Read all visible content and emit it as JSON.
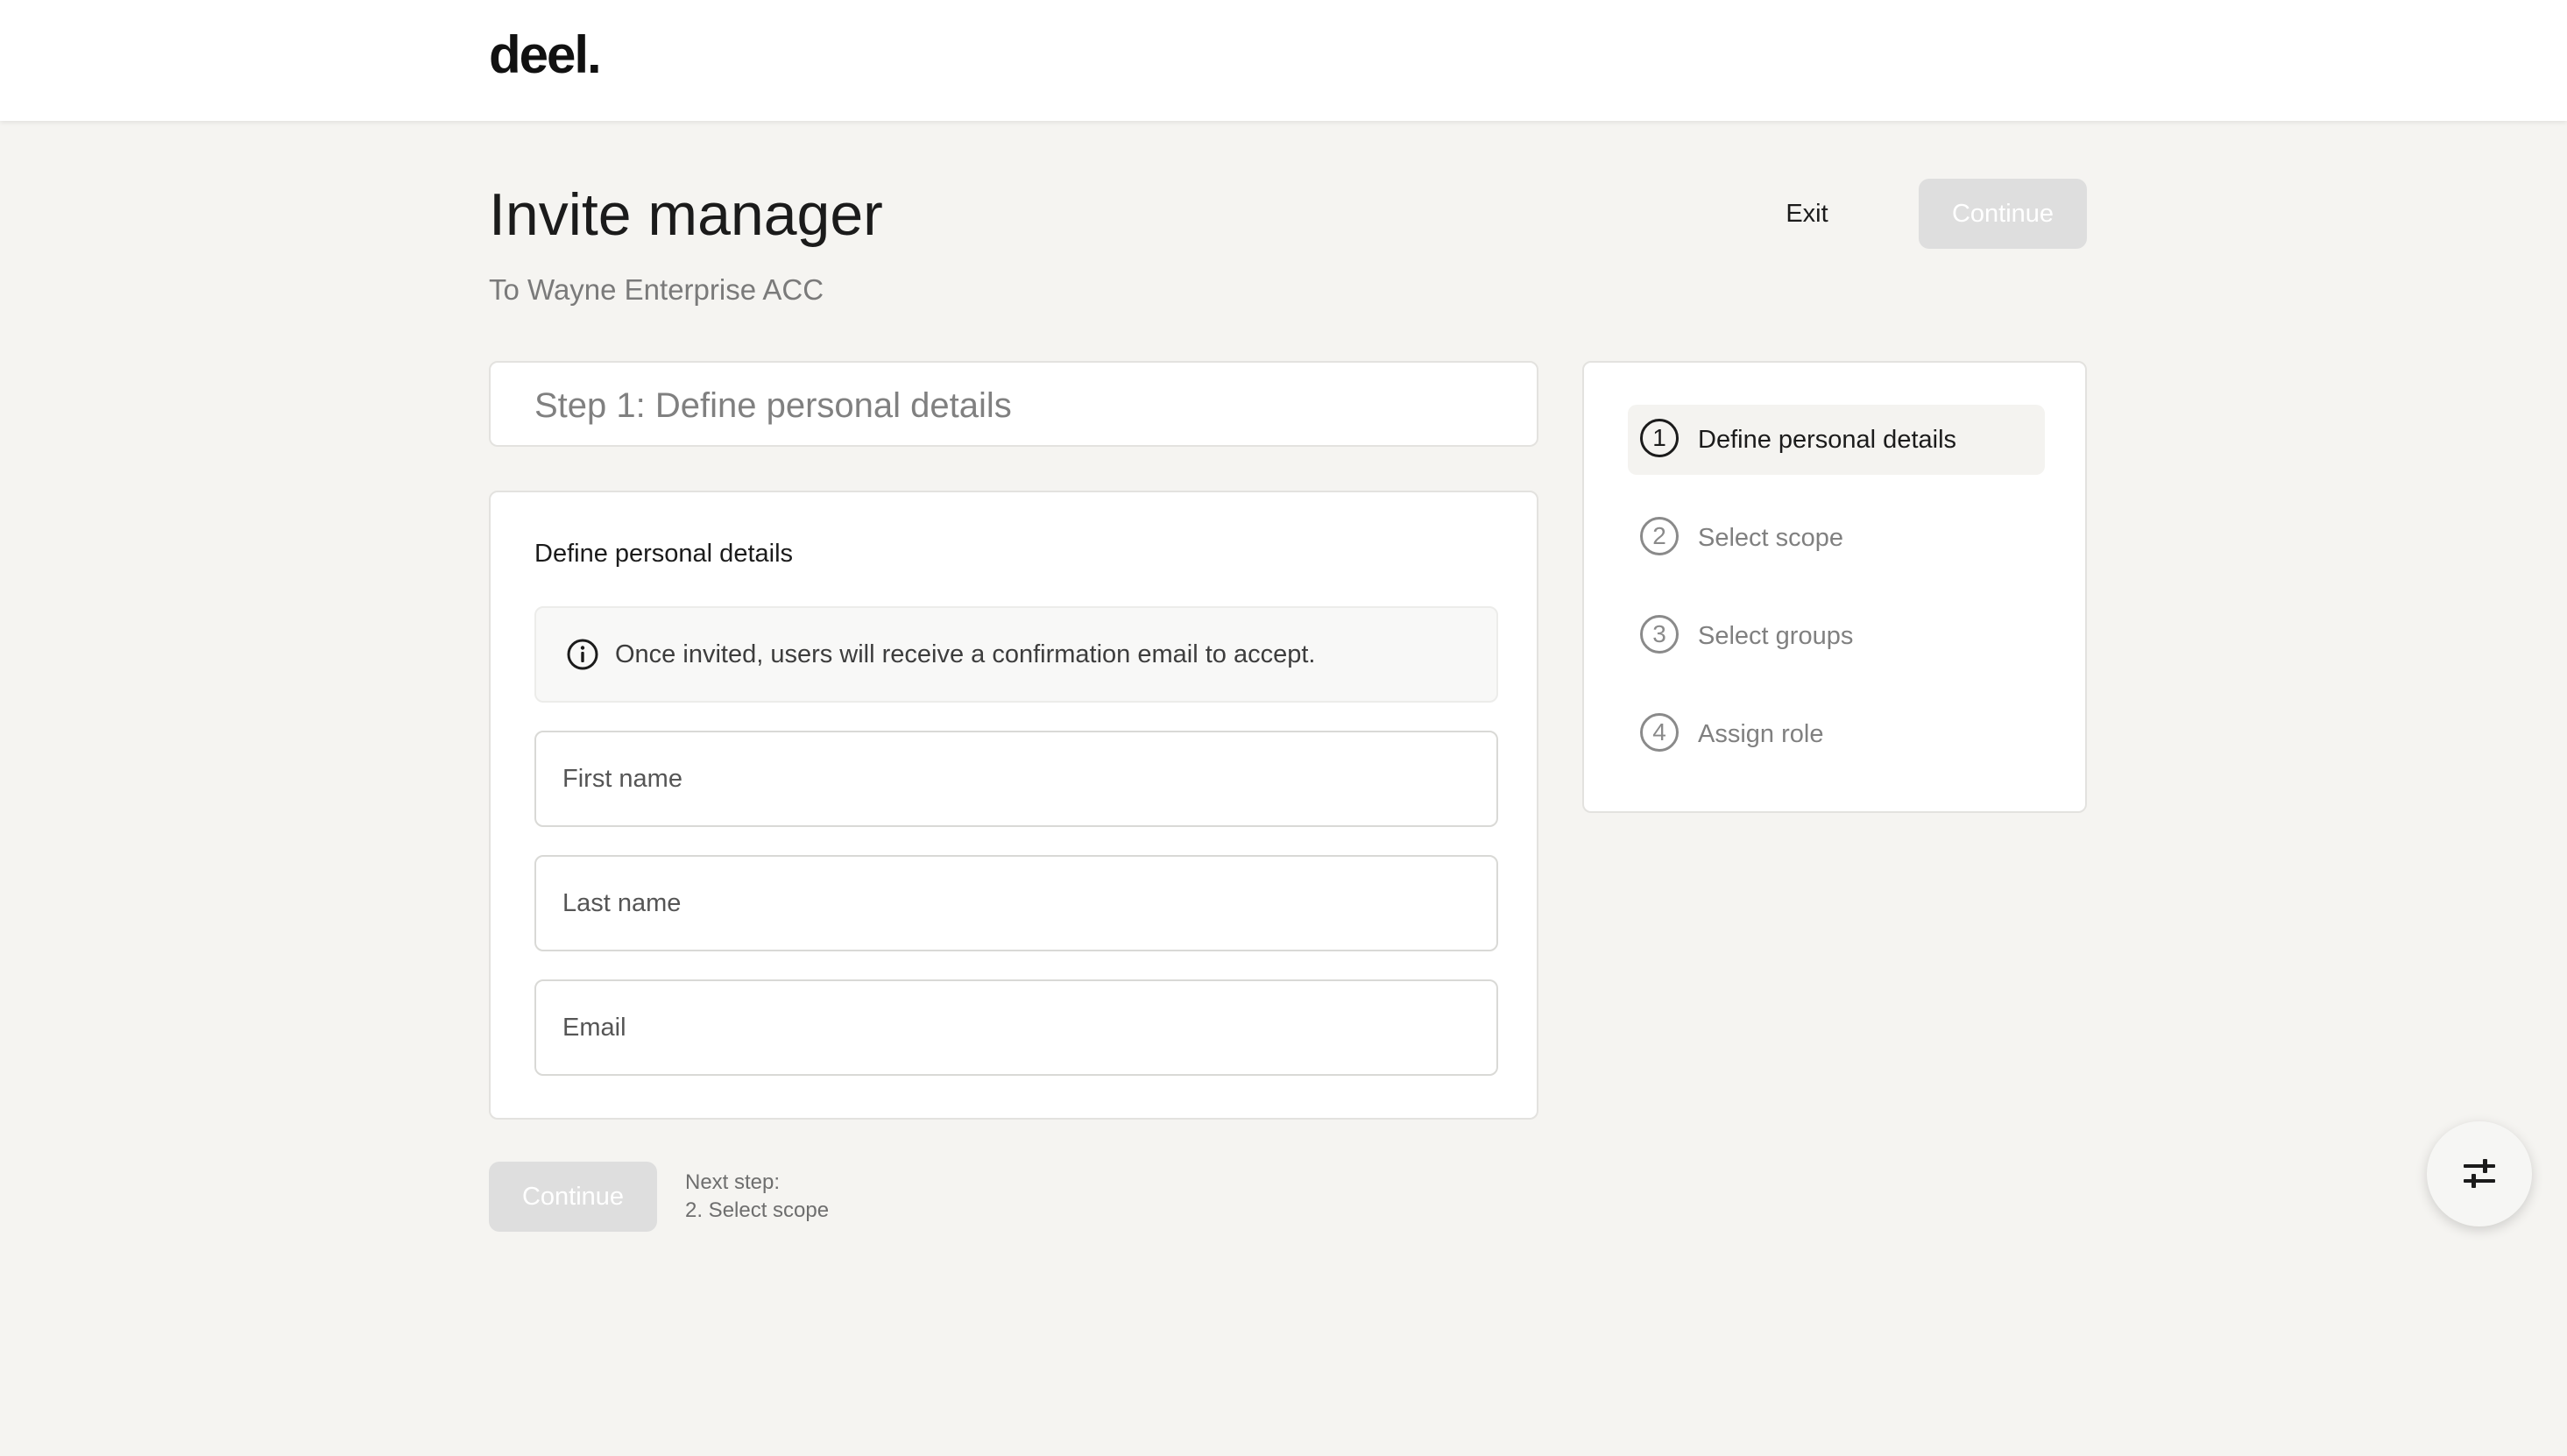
{
  "header": {
    "logo_text": "deel."
  },
  "page": {
    "title": "Invite manager",
    "subtitle": "To Wayne Enterprise ACC",
    "exit_label": "Exit",
    "continue_label": "Continue"
  },
  "step_header": {
    "text": "Step 1: Define personal details"
  },
  "form": {
    "title": "Define personal details",
    "info_text": "Once invited, users will receive a confirmation email to accept.",
    "first_name": {
      "placeholder": "First name",
      "value": ""
    },
    "last_name": {
      "placeholder": "Last name",
      "value": ""
    },
    "email": {
      "placeholder": "Email",
      "value": ""
    }
  },
  "footer": {
    "continue_label": "Continue",
    "next_step_label": "Next step:",
    "next_step_value": "2. Select scope"
  },
  "stepper": {
    "items": [
      {
        "number": "1",
        "label": "Define personal details",
        "active": true
      },
      {
        "number": "2",
        "label": "Select scope",
        "active": false
      },
      {
        "number": "3",
        "label": "Select groups",
        "active": false
      },
      {
        "number": "4",
        "label": "Assign role",
        "active": false
      }
    ]
  },
  "fab": {
    "icon": "sliders-icon"
  },
  "colors": {
    "background": "#f5f4f1",
    "card": "#ffffff",
    "disabled_button": "#dedede",
    "muted_text": "#808080",
    "primary_text": "#1b1b1b"
  }
}
